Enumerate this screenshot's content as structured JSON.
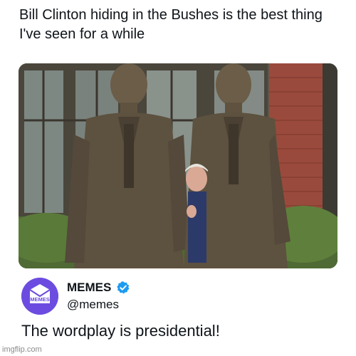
{
  "post": {
    "text": "Bill Clinton hiding in the Bushes is the best thing I've seen for a while",
    "image_icon": "photo-statues-with-person-behind"
  },
  "reply": {
    "avatar_text": "MEMES",
    "avatar_color": "#6c4ce0",
    "display_name": "MEMES",
    "verified_icon": "verified-badge-icon",
    "verified_color": "#1d9bf0",
    "handle": "@memes",
    "text": "The wordplay is presidential!"
  },
  "watermark": {
    "text": "imgflip.com"
  }
}
